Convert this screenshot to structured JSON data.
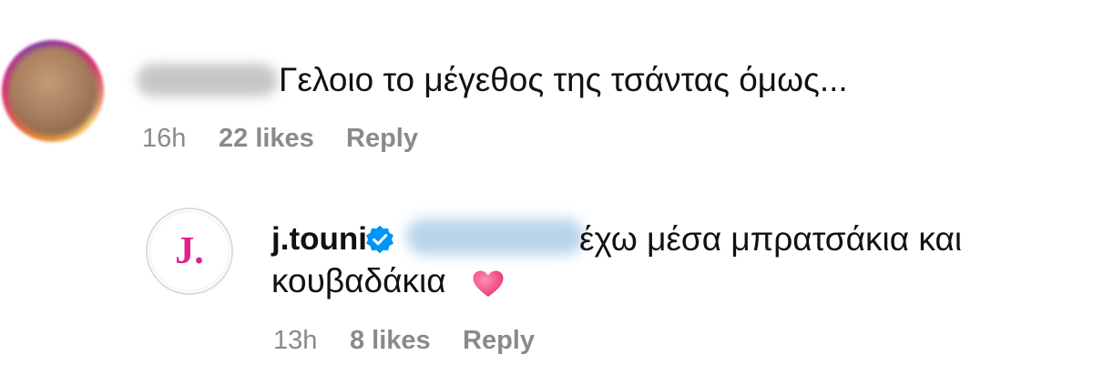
{
  "comment": {
    "avatar_icon": "blurred-user-avatar",
    "text": "Γελοιο το μέγεθος της τσάντας όμως...",
    "time": "16h",
    "likes": "22 likes",
    "reply_label": "Reply"
  },
  "reply": {
    "avatar_logo": "J.",
    "username": "j.touni",
    "verified_icon": "verified-badge-icon",
    "text_line1": "έχω μέσα μπρατσάκια και",
    "text_line2": "κουβαδάκια",
    "emoji_icon": "pink-heart-icon",
    "time": "13h",
    "likes": "8 likes",
    "reply_label": "Reply"
  },
  "colors": {
    "meta_text": "#8a8a8a",
    "brand_pink": "#e0218a",
    "verified_blue": "#0095f6",
    "heart_pink": "#f2578e"
  }
}
